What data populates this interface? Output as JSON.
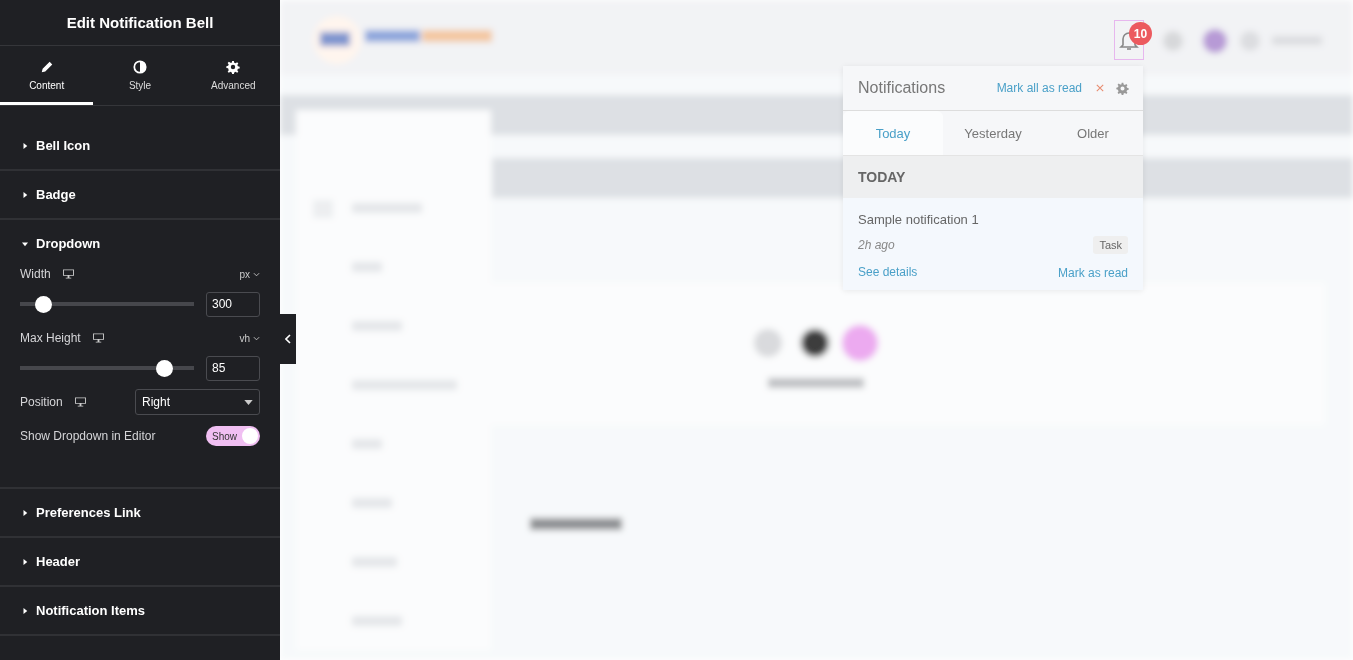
{
  "panel": {
    "title": "Edit Notification Bell",
    "tabs": [
      {
        "label": "Content",
        "selected": true
      },
      {
        "label": "Style",
        "selected": false
      },
      {
        "label": "Advanced",
        "selected": false
      }
    ],
    "sections": [
      {
        "label": "Bell Icon",
        "expanded": false
      },
      {
        "label": "Badge",
        "expanded": false
      },
      {
        "label": "Dropdown",
        "expanded": true,
        "controls": [
          {
            "kind": "slider",
            "label": "Width",
            "unit": "px",
            "level": 0.13,
            "value": "300"
          },
          {
            "kind": "slider",
            "label": "Max Height",
            "unit": "vh",
            "level": 0.83,
            "value": "85"
          },
          {
            "kind": "select",
            "label": "Position",
            "value": "Right"
          },
          {
            "kind": "switch",
            "label": "Show Dropdown in Editor",
            "on": true,
            "text": "Show"
          }
        ]
      },
      {
        "label": "Preferences Link",
        "expanded": false
      },
      {
        "label": "Header",
        "expanded": false
      },
      {
        "label": "Notification Items",
        "expanded": false
      }
    ]
  },
  "bell": {
    "badge": "10"
  },
  "dropdown": {
    "title": "Notifications",
    "mark_all": "Mark all as read",
    "tabs": [
      {
        "label": "Today",
        "selected": true
      },
      {
        "label": "Yesterday",
        "selected": false
      },
      {
        "label": "Older",
        "selected": false
      }
    ],
    "groups": [
      {
        "heading": "TODAY",
        "items": [
          {
            "title": "Sample notification 1",
            "time": "2h ago",
            "tag": "Task",
            "details_link": "See details",
            "mark_read": "Mark as read"
          }
        ]
      }
    ]
  }
}
